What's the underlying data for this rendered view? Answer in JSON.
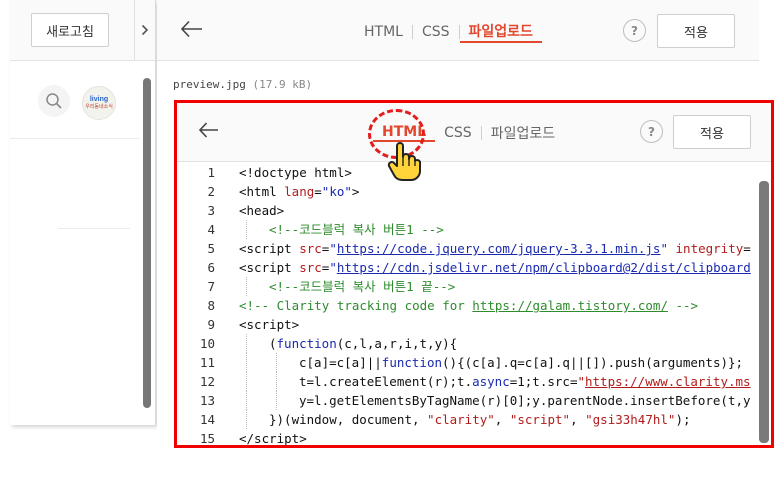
{
  "left_panel": {
    "refresh_label": "새로고침",
    "expand_icon": "chevron-right-icon",
    "search_icon": "search-icon",
    "logo": {
      "line1": "living",
      "line2": "우리동네소식"
    }
  },
  "editor": {
    "tabs": [
      {
        "label": "HTML",
        "active": false
      },
      {
        "label": "CSS",
        "active": false
      },
      {
        "label": "파일업로드",
        "active": true
      }
    ],
    "help_label": "?",
    "apply_label": "적용",
    "preview_file": "preview.jpg",
    "preview_size": "(17.9 kB)"
  },
  "screenshot": {
    "tabs": [
      {
        "label": "HTML",
        "active": true
      },
      {
        "label": "CSS",
        "active": false
      },
      {
        "label": "파일업로드",
        "active": false
      }
    ],
    "help_label": "?",
    "apply_label": "적용",
    "highlight_color": "#e31c1c",
    "border_color": "#f20000",
    "code_lines": [
      {
        "num": "1",
        "html": "&lt;!doctype html&gt;"
      },
      {
        "num": "2",
        "html": "&lt;html <span class=\"a\">lang</span>=<span class=\"s\">\"ko\"</span>&gt;"
      },
      {
        "num": "3",
        "html": "&lt;head&gt;"
      },
      {
        "num": "4",
        "indent": 1,
        "html": "<span class=\"c\">&lt;!--코드블럭 복사 버튼1 --&gt;</span>"
      },
      {
        "num": "5",
        "html": "&lt;script <span class=\"a\">src</span>=<span class=\"s\">\"</span><span class=\"u\">https://code.jquery.com/jquery-3.3.1.min.js</span><span class=\"s\">\"</span> <span class=\"a\">integrity</span>="
      },
      {
        "num": "6",
        "html": "&lt;script <span class=\"a\">src</span>=<span class=\"s\">\"</span><span class=\"u\">https://cdn.jsdelivr.net/npm/clipboard@2/dist/clipboard</span>"
      },
      {
        "num": "7",
        "indent": 1,
        "html": "<span class=\"c\">&lt;!--코드블럭 복사 버튼1 끝--&gt;</span>"
      },
      {
        "num": "8",
        "html": "<span class=\"c\">&lt;!-- Clarity tracking code for </span><span class=\"cu\">https://galam.tistory.com/</span><span class=\"c\"> --&gt;</span>"
      },
      {
        "num": "9",
        "html": "&lt;script&gt;"
      },
      {
        "num": "10",
        "indent": 1,
        "html": "(<span class=\"kw\">function</span>(c,l,a,r,i,t,y){"
      },
      {
        "num": "11",
        "indent": 2,
        "html": "c[a]=c[a]||<span class=\"kw\">function</span>(){(c[a].q=c[a].q||[]).push(arguments)};"
      },
      {
        "num": "12",
        "indent": 2,
        "html": "t=l.createElement(r);t.<span class=\"kw\">async</span>=1;t.src=<span class=\"str\">\"</span><span class=\"str-u\">https://www.clarity.ms</span>"
      },
      {
        "num": "13",
        "indent": 2,
        "html": "y=l.getElementsByTagName(r)[0];y.parentNode.insertBefore(t,y"
      },
      {
        "num": "14",
        "indent": 1,
        "html": "})(window, document, <span class=\"str\">\"clarity\"</span>, <span class=\"str\">\"script\"</span>, <span class=\"str\">\"gsi33h47hl\"</span>);"
      },
      {
        "num": "15",
        "html": "&lt;/script&gt;"
      }
    ]
  }
}
